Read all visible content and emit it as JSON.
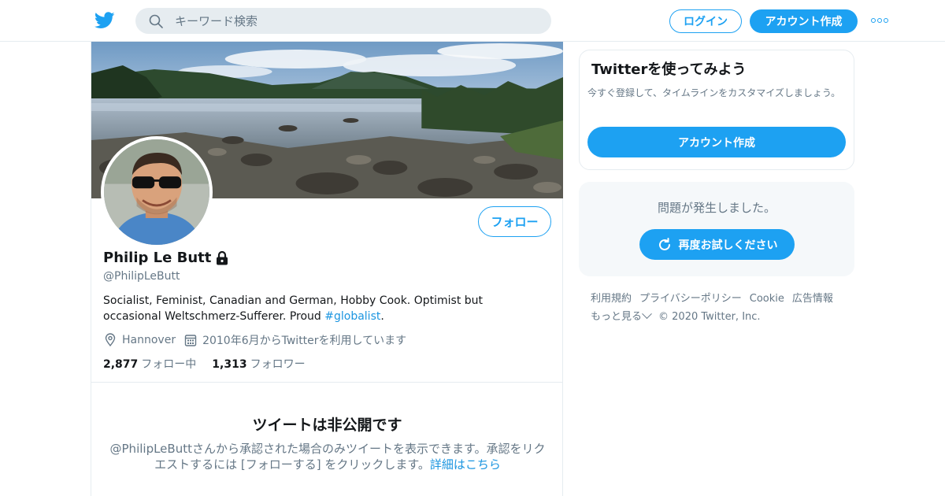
{
  "header": {
    "search_placeholder": "キーワード検索",
    "login_label": "ログイン",
    "signup_label": "アカウント作成"
  },
  "profile": {
    "follow_label": "フォロー",
    "name": "Philip Le Butt",
    "handle": "@PhilipLeButt",
    "bio_text": "Socialist, Feminist, Canadian and German, Hobby Cook. Optimist but occasional Weltschmerz-Sufferer. Proud ",
    "bio_hashtag": "#globalist",
    "bio_end": ".",
    "location": "Hannover",
    "joined": "2010年6月からTwitterを利用しています",
    "following_count": "2,877",
    "following_label": "フォロー中",
    "followers_count": "1,313",
    "followers_label": "フォロワー"
  },
  "protected": {
    "title": "ツイートは非公開です",
    "text": "@PhilipLeButtさんから承認された場合のみツイートを表示できます。承認をリクエストするには [フォローする] をクリックします。",
    "link": "詳細はこちら"
  },
  "sidebar": {
    "join_title": "Twitterを使ってみよう",
    "join_text": "今すぐ登録して、タイムラインをカスタマイズしましょう。",
    "join_cta": "アカウント作成",
    "error_text": "問題が発生しました。",
    "retry_label": "再度お試しください"
  },
  "footer": {
    "links": [
      "利用規約",
      "プライバシーポリシー",
      "Cookie",
      "広告情報"
    ],
    "more": "もっと見る",
    "copyright": "© 2020 Twitter, Inc."
  },
  "colors": {
    "accent": "#1da1f2",
    "link": "#1b95e0",
    "secondary_text": "#657786",
    "border": "#e6ecf0"
  }
}
